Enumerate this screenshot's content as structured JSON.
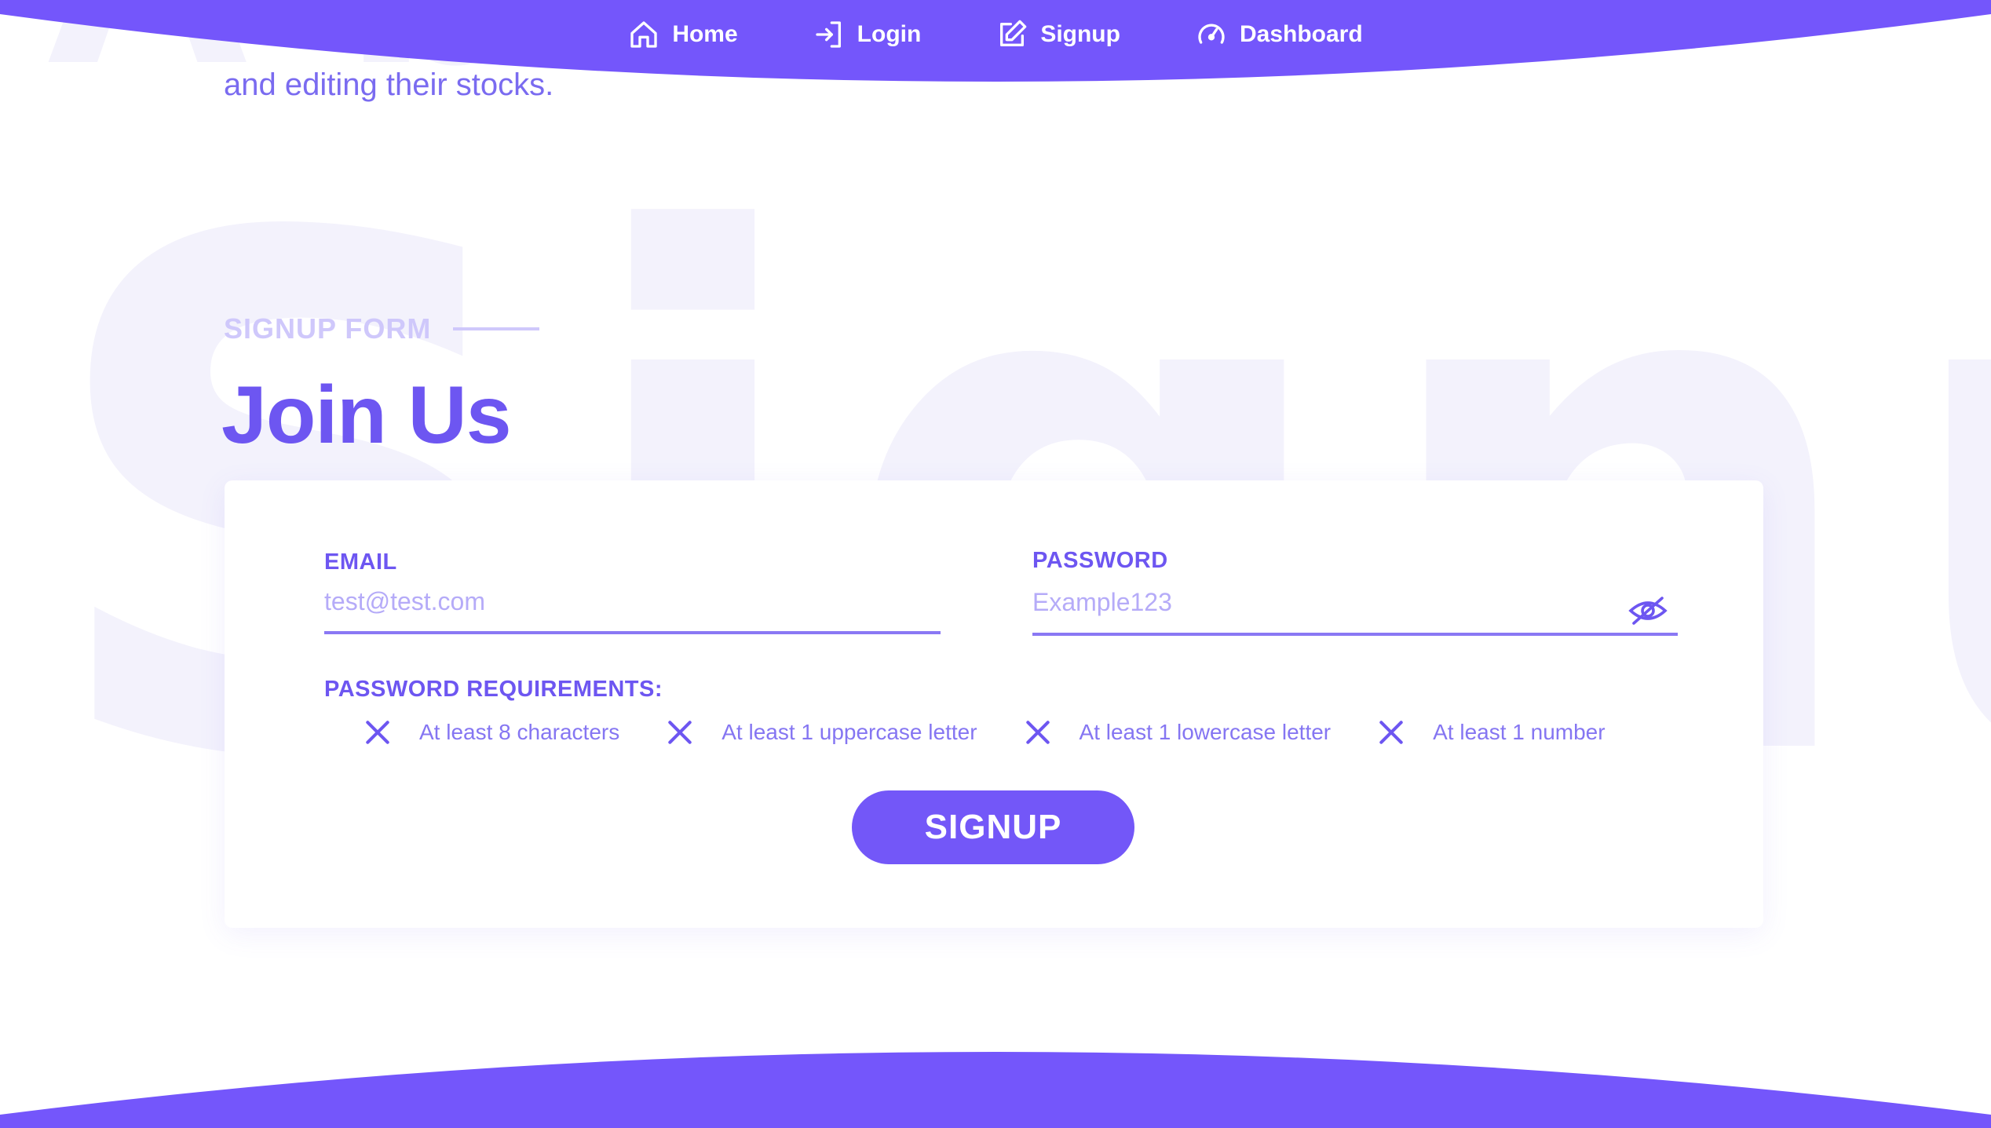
{
  "colors": {
    "accent": "#7357f8",
    "nav_band": "#7456fb",
    "heading": "#6d56f1",
    "muted_label": "#cfc8fb",
    "placeholder": "#b5abf8",
    "watermark": "#f3f2fc"
  },
  "nav": {
    "items": [
      {
        "label": "Home",
        "icon": "home-icon"
      },
      {
        "label": "Login",
        "icon": "login-icon"
      },
      {
        "label": "Signup",
        "icon": "edit-icon"
      },
      {
        "label": "Dashboard",
        "icon": "speedometer-icon"
      }
    ]
  },
  "background": {
    "word": "Signup"
  },
  "intro": {
    "text": "and editing their stocks."
  },
  "section": {
    "eyebrow": "SIGNUP FORM",
    "title": "Join Us"
  },
  "form": {
    "email_label": "EMAIL",
    "email_placeholder": "test@test.com",
    "password_label": "PASSWORD",
    "password_placeholder": "Example123",
    "password_toggle_icon": "eye-slash-icon",
    "requirements_label": "PASSWORD REQUIREMENTS:",
    "requirements": [
      {
        "text": "At least 8 characters",
        "icon": "x-icon"
      },
      {
        "text": "At least 1 uppercase letter",
        "icon": "x-icon"
      },
      {
        "text": "At least 1 lowercase letter",
        "icon": "x-icon"
      },
      {
        "text": "At least 1 number",
        "icon": "x-icon"
      }
    ],
    "submit_label": "SIGNUP"
  }
}
